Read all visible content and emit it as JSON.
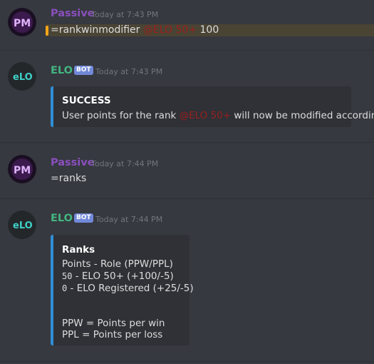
{
  "messages": [
    {
      "author": "Passive",
      "timestamp": "Today at 7:43 PM",
      "text_prefix": "=rankwinmodifier ",
      "mention": "@ELO 50+",
      "text_suffix": " 100"
    },
    {
      "author": "ELO",
      "bot_tag": "BOT",
      "timestamp": "Today at 7:43 PM",
      "embed": {
        "title": "SUCCESS",
        "line_prefix": "User points for the rank ",
        "mention": "@ELO 50+",
        "line_suffix": " will now be modified accordingly"
      }
    },
    {
      "author": "Passive",
      "timestamp": "Today at 7:44 PM",
      "text": "=ranks"
    },
    {
      "author": "ELO",
      "bot_tag": "BOT",
      "timestamp": "Today at 7:44 PM",
      "embed": {
        "title": "Ranks",
        "header_line": "Points - Role (PPW/PPL)",
        "rows": [
          {
            "points": "50",
            "role": " - ELO 50+ (+100/-5)"
          },
          {
            "points": "0",
            "role": " - ELO Registered (+25/-5)"
          }
        ],
        "legend_ppw": "PPW = Points per win",
        "legend_ppl": "PPL = Points per loss"
      }
    }
  ],
  "colors": {
    "background": "#36393f",
    "passive_name": "#8a4fbd",
    "bot_name": "#43b581",
    "bot_tag": "#7289da",
    "embed_border": "#2f8fd8",
    "mention": "#9a1f1f",
    "highlight": "#faa61a"
  }
}
